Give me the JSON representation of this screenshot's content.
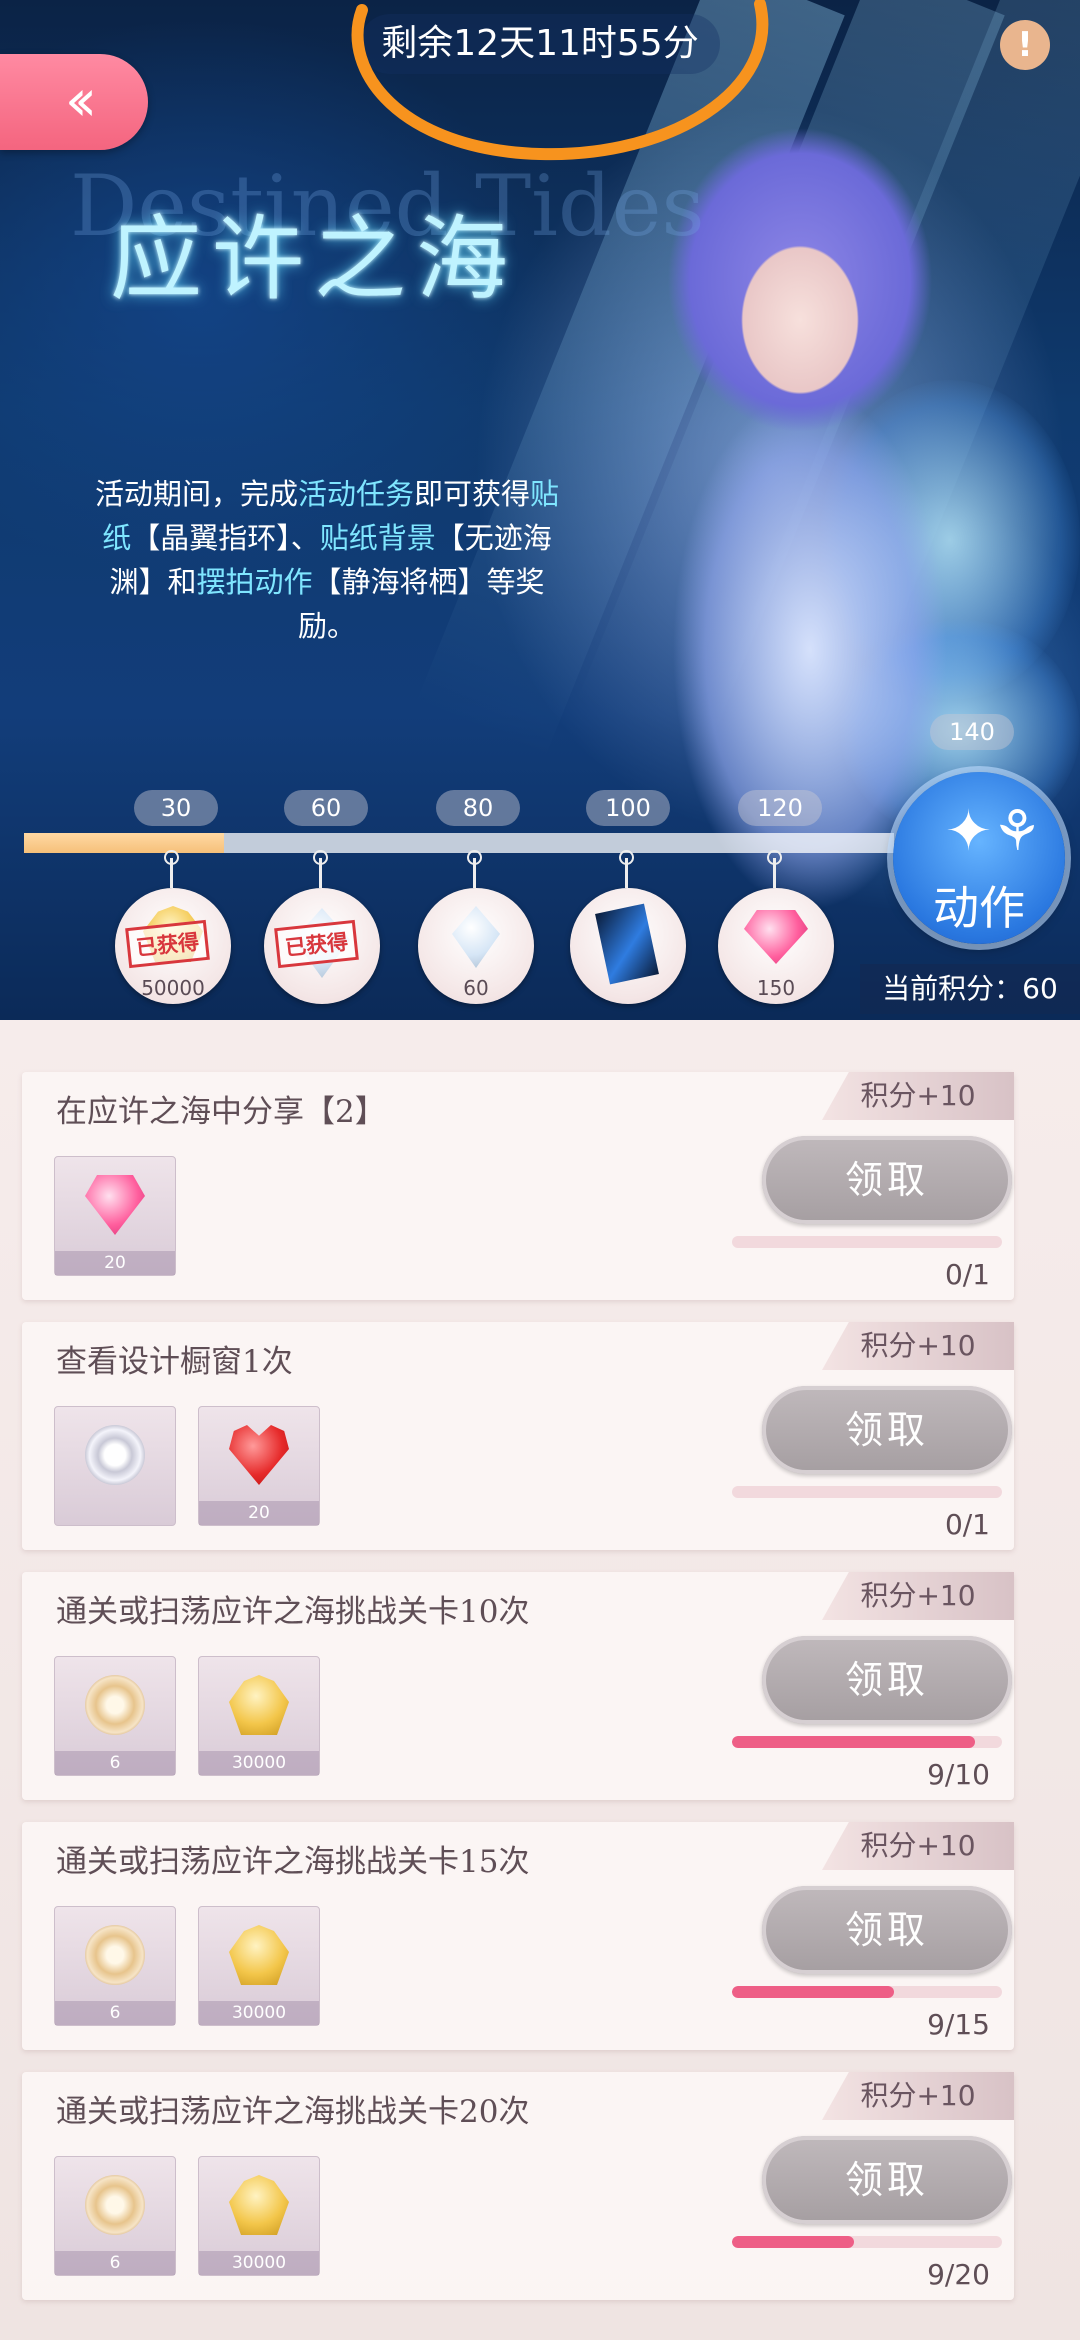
{
  "banner": {
    "timer": "剩余12天11时55分",
    "back_icon": "double-chevron-left-icon",
    "info_icon": "exclamation-icon",
    "info_label": "!",
    "title_en": "Destined Tides",
    "title_cn": "应许之海",
    "description": {
      "p1": "活动期间，完成",
      "h1": "活动任务",
      "p2": "即可获得",
      "h2": "贴纸",
      "p3": "【晶翼指环】、",
      "h3": "贴纸背景",
      "p4": "【无迹海渊】和",
      "h4": "摆拍动作",
      "p5": "【静海将栖】等奖励。"
    },
    "progress": {
      "fraction": 0.23,
      "milestones": [
        "30",
        "60",
        "80",
        "100",
        "120",
        "140"
      ]
    },
    "rewards": [
      {
        "qty": "50000",
        "stamp": "已获得",
        "icon": "gold-crown-icon"
      },
      {
        "qty": "",
        "stamp": "已获得",
        "icon": "crystal-wing-ring-icon"
      },
      {
        "qty": "60",
        "stamp": "",
        "icon": "white-diamond-icon"
      },
      {
        "qty": "",
        "stamp": "",
        "icon": "blue-card-icon"
      },
      {
        "qty": "150",
        "stamp": "",
        "icon": "pink-gem-icon"
      }
    ],
    "dance_button": {
      "label": "动作",
      "icon": "dancing-people-icon"
    },
    "current_score": "当前积分：60"
  },
  "tasks": [
    {
      "title": "在应许之海中分享【2】",
      "points": "积分+10",
      "button": "领取",
      "count": "0/1",
      "progress": 0.0,
      "items": [
        {
          "icon": "pink-gem-icon",
          "qty": "20"
        }
      ]
    },
    {
      "title": "查看设计橱窗1次",
      "points": "积分+10",
      "button": "领取",
      "count": "0/1",
      "progress": 0.0,
      "items": [
        {
          "icon": "silver-ring-icon",
          "qty": ""
        },
        {
          "icon": "red-heart-gem-icon",
          "qty": "20"
        }
      ]
    },
    {
      "title": "通关或扫荡应许之海挑战关卡10次",
      "points": "积分+10",
      "button": "领取",
      "count": "9/10",
      "progress": 0.9,
      "items": [
        {
          "icon": "gold-flower-icon",
          "qty": "6"
        },
        {
          "icon": "gold-coin-gem-icon",
          "qty": "30000"
        }
      ]
    },
    {
      "title": "通关或扫荡应许之海挑战关卡15次",
      "points": "积分+10",
      "button": "领取",
      "count": "9/15",
      "progress": 0.6,
      "items": [
        {
          "icon": "gold-flower-icon",
          "qty": "6"
        },
        {
          "icon": "gold-coin-gem-icon",
          "qty": "30000"
        }
      ]
    },
    {
      "title": "通关或扫荡应许之海挑战关卡20次",
      "points": "积分+10",
      "button": "领取",
      "count": "9/20",
      "progress": 0.45,
      "items": [
        {
          "icon": "gold-flower-icon",
          "qty": "6"
        },
        {
          "icon": "gold-coin-gem-icon",
          "qty": "30000"
        }
      ]
    }
  ],
  "colors": {
    "accent_pink": "#ee5e86",
    "highlight_cyan": "#7fe6ff",
    "scribble_orange": "#f7931e"
  }
}
